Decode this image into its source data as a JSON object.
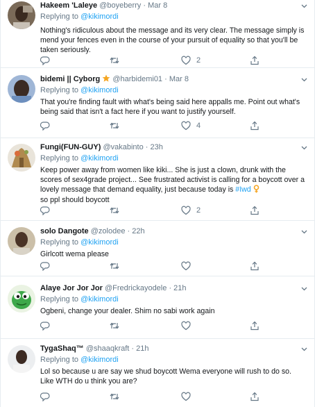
{
  "tweets": [
    {
      "name": "Hakeem 'Laleye",
      "handle": "@boyeberry",
      "time": "Mar 8",
      "replying_label": "Replying to",
      "replying_to": "@kikimordi",
      "text": "Nothing's ridiculous about the message and its very clear. The message simply is mend your fences even in the course of your pursuit of equality  so that you'll be taken seriously.",
      "likes": "2"
    },
    {
      "name": "bidemi || Cyborg",
      "handle": "@harbidemi01",
      "time": "Mar 8",
      "replying_label": "Replying to",
      "replying_to": "@kikimordi",
      "text": "That you're finding fault with what's being said here appalls me. Point out what's being said that isn't a fact here if you want to justify yourself.",
      "likes": "4"
    },
    {
      "name": "Fungi(FUN-GUY)",
      "handle": "@vakabinto",
      "time": "23h",
      "replying_label": "Replying to",
      "replying_to": "@kikimordi",
      "text_before": "Keep power away from women like kiki... She is just a clown, drunk with the scores of sex4grade project... See frustrated activist is calling for a boycott over a lovely message that demand equality, just because today is ",
      "hashtag": "#Iwd",
      "text_after": " so ppl should boycott",
      "likes": "2"
    },
    {
      "name": "solo Dangote",
      "handle": "@zolodee",
      "time": "22h",
      "replying_label": "Replying to",
      "replying_to": "@kikimordi",
      "text": "Girlcott wema please",
      "likes": ""
    },
    {
      "name": "Alaye Jor Jor Jor",
      "handle": "@Fredrickayodele",
      "time": "21h",
      "replying_label": "Replying to",
      "replying_to": "@kikimordi",
      "text": "Ogbeni, change your dealer. Shim no sabi work again",
      "likes": ""
    },
    {
      "name": "TygaShaq™",
      "handle": "@shaaqkraft",
      "time": "21h",
      "replying_label": "Replying to",
      "replying_to": "@kikimordi",
      "text": "Lol so because u are say we shud boycott Wema everyone will rush to do so. Like WTH do u think you are?",
      "likes": ""
    }
  ],
  "dot": "·",
  "icons": {
    "reply": "reply-icon",
    "retweet": "retweet-icon",
    "like": "heart-icon",
    "share": "share-icon",
    "menu": "chevron-down-icon",
    "badge": "verified-star-icon",
    "emoji": "woman-symbol-emoji"
  },
  "colors": {
    "link": "#1da1f2",
    "muted": "#657786",
    "border": "#e6ecf0",
    "badge": "#f5a623"
  }
}
